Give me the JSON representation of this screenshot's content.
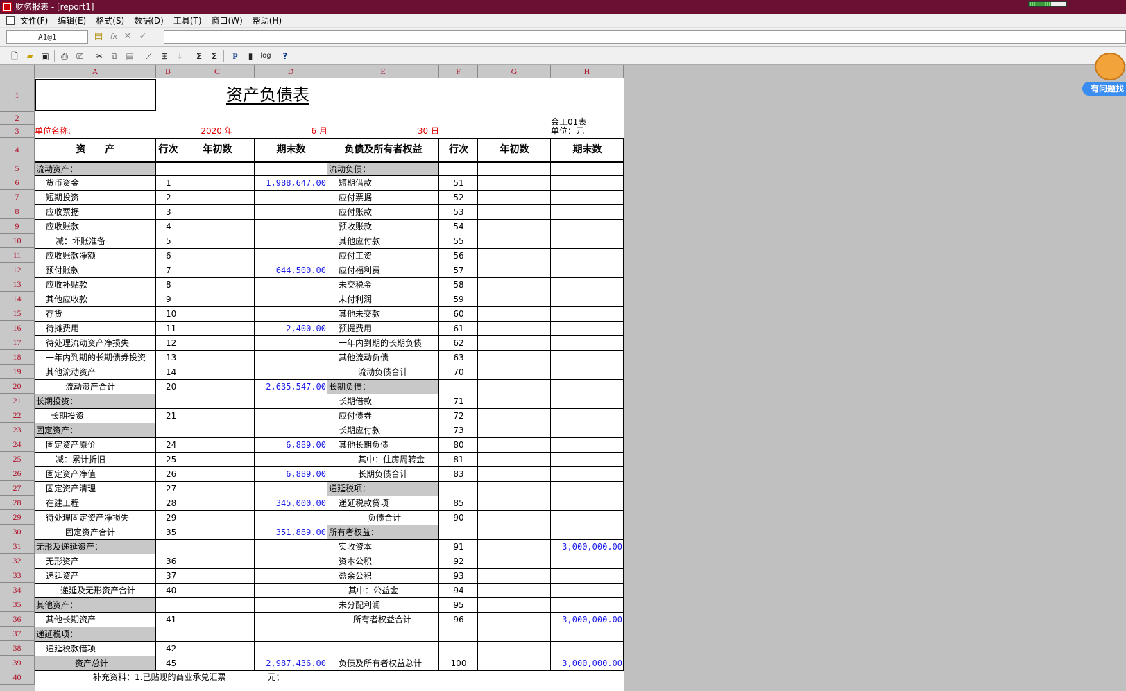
{
  "window": {
    "title": "财务报表 - [report1]",
    "progress_fraction": 0.6
  },
  "menu": [
    "文件(F)",
    "编辑(E)",
    "格式(S)",
    "数据(D)",
    "工具(T)",
    "窗口(W)",
    "帮助(H)"
  ],
  "formula": {
    "cell_ref": "A1@1",
    "fx": "fx",
    "content": ""
  },
  "toolbar": {
    "sum_label": "Σ",
    "sum2_label": "Σ",
    "p_label": "P",
    "log_label": "log",
    "help_label": "?"
  },
  "assistant": {
    "label": "有问题找"
  },
  "columns": [
    "A",
    "B",
    "C",
    "D",
    "E",
    "F",
    "G",
    "H"
  ],
  "rows": [
    "1",
    "2",
    "3",
    "4",
    "5",
    "6",
    "7",
    "8",
    "9",
    "10",
    "11",
    "12",
    "13",
    "14",
    "15",
    "16",
    "17",
    "18",
    "19",
    "20",
    "21",
    "22",
    "23",
    "24",
    "25",
    "26",
    "27",
    "28",
    "29",
    "30",
    "31",
    "32",
    "33",
    "34",
    "35",
    "36",
    "37",
    "38",
    "39",
    "40"
  ],
  "report": {
    "title": "资产负债表",
    "form_no": "会工01表",
    "unit_label": "单位名称:",
    "year": "2020 年",
    "month": "6 月",
    "day": "30 日",
    "currency": "单位：元",
    "headers": {
      "asset": "资　　产",
      "line": "行次",
      "begin": "年初数",
      "end": "期末数",
      "liab": "负债及所有者权益",
      "line2": "行次",
      "begin2": "年初数",
      "end2": "期末数"
    },
    "footer": "补充资料：1.已贴现的商业承兑汇票　　　　　元；",
    "body": [
      {
        "a": "流动资产：",
        "b": "",
        "d": "",
        "e": "流动负债：",
        "f": "",
        "h": "",
        "ash": true,
        "esh": true,
        "ai": 0,
        "ei": 0
      },
      {
        "a": "货币资金",
        "b": "1",
        "d": "1,988,647.00",
        "e": "短期借款",
        "f": "51",
        "h": "",
        "ai": 1,
        "ei": 1
      },
      {
        "a": "短期投资",
        "b": "2",
        "d": "",
        "e": "应付票据",
        "f": "52",
        "h": "",
        "ai": 1,
        "ei": 1
      },
      {
        "a": "应收票据",
        "b": "3",
        "d": "",
        "e": "应付账款",
        "f": "53",
        "h": "",
        "ai": 1,
        "ei": 1
      },
      {
        "a": "应收账款",
        "b": "4",
        "d": "",
        "e": "预收账款",
        "f": "54",
        "h": "",
        "ai": 1,
        "ei": 1
      },
      {
        "a": "减：坏账准备",
        "b": "5",
        "d": "",
        "e": "其他应付款",
        "f": "55",
        "h": "",
        "ai": 2,
        "ei": 1
      },
      {
        "a": "应收账款净额",
        "b": "6",
        "d": "",
        "e": "应付工资",
        "f": "56",
        "h": "",
        "ai": 1,
        "ei": 1
      },
      {
        "a": "预付账款",
        "b": "7",
        "d": "644,500.00",
        "e": "应付福利费",
        "f": "57",
        "h": "",
        "ai": 1,
        "ei": 1
      },
      {
        "a": "应收补贴款",
        "b": "8",
        "d": "",
        "e": "未交税金",
        "f": "58",
        "h": "",
        "ai": 1,
        "ei": 1
      },
      {
        "a": "其他应收款",
        "b": "9",
        "d": "",
        "e": "未付利润",
        "f": "59",
        "h": "",
        "ai": 1,
        "ei": 1
      },
      {
        "a": "存货",
        "b": "10",
        "d": "",
        "e": "其他未交款",
        "f": "60",
        "h": "",
        "ai": 1,
        "ei": 1
      },
      {
        "a": "待摊费用",
        "b": "11",
        "d": "2,400.00",
        "e": "预提费用",
        "f": "61",
        "h": "",
        "ai": 1,
        "ei": 1
      },
      {
        "a": "待处理流动资产净损失",
        "b": "12",
        "d": "",
        "e": "一年内到期的长期负债",
        "f": "62",
        "h": "",
        "ai": 1,
        "ei": 1
      },
      {
        "a": "一年内到期的长期债券投资",
        "b": "13",
        "d": "",
        "e": "其他流动负债",
        "f": "63",
        "h": "",
        "ai": 1,
        "ei": 1
      },
      {
        "a": "其他流动资产",
        "b": "14",
        "d": "",
        "e": "流动负债合计",
        "f": "70",
        "h": "",
        "ai": 1,
        "ei": 3
      },
      {
        "a": "流动资产合计",
        "b": "20",
        "d": "2,635,547.00",
        "e": "长期负债：",
        "f": "",
        "h": "",
        "ai": 3,
        "ei": 0,
        "esh": true
      },
      {
        "a": "长期投资：",
        "b": "",
        "d": "",
        "e": "长期借款",
        "f": "71",
        "h": "",
        "ash": true,
        "ai": 0,
        "ei": 1
      },
      {
        "a": "长期投资",
        "b": "21",
        "d": "",
        "e": "应付债券",
        "f": "72",
        "h": "",
        "ai": 1.5,
        "ei": 1
      },
      {
        "a": "固定资产：",
        "b": "",
        "d": "",
        "e": "长期应付款",
        "f": "73",
        "h": "",
        "ash": true,
        "ai": 0,
        "ei": 1
      },
      {
        "a": "固定资产原价",
        "b": "24",
        "d": "6,889.00",
        "e": "其他长期负债",
        "f": "80",
        "h": "",
        "ai": 1,
        "ei": 1
      },
      {
        "a": "减：累计折旧",
        "b": "25",
        "d": "",
        "e": "其中：住房周转金",
        "f": "81",
        "h": "",
        "ai": 2,
        "ei": 3
      },
      {
        "a": "固定资产净值",
        "b": "26",
        "d": "6,889.00",
        "e": "长期负债合计",
        "f": "83",
        "h": "",
        "ai": 1,
        "ei": 3
      },
      {
        "a": "固定资产清理",
        "b": "27",
        "d": "",
        "e": "递延税项：",
        "f": "",
        "h": "",
        "ai": 1,
        "ei": 0,
        "esh": true
      },
      {
        "a": "在建工程",
        "b": "28",
        "d": "345,000.00",
        "e": "递延税款贷项",
        "f": "85",
        "h": "",
        "ai": 1,
        "ei": 1
      },
      {
        "a": "待处理固定资产净损失",
        "b": "29",
        "d": "",
        "e": "负债合计",
        "f": "90",
        "h": "",
        "ai": 1,
        "ei": 4
      },
      {
        "a": "固定资产合计",
        "b": "35",
        "d": "351,889.00",
        "e": "所有者权益：",
        "f": "",
        "h": "",
        "ai": 3,
        "ei": 0,
        "esh": true
      },
      {
        "a": "无形及递延资产：",
        "b": "",
        "d": "",
        "e": "实收资本",
        "f": "91",
        "h": "3,000,000.00",
        "ash": true,
        "ai": 0,
        "ei": 1
      },
      {
        "a": "无形资产",
        "b": "36",
        "d": "",
        "e": "资本公积",
        "f": "92",
        "h": "",
        "ai": 1,
        "ei": 1
      },
      {
        "a": "递延资产",
        "b": "37",
        "d": "",
        "e": "盈余公积",
        "f": "93",
        "h": "",
        "ai": 1,
        "ei": 1
      },
      {
        "a": "递延及无形资产合计",
        "b": "40",
        "d": "",
        "e": "其中：公益金",
        "f": "94",
        "h": "",
        "ai": 2.5,
        "ei": 2
      },
      {
        "a": "其他资产：",
        "b": "",
        "d": "",
        "e": "未分配利润",
        "f": "95",
        "h": "",
        "ash": true,
        "ai": 0,
        "ei": 1
      },
      {
        "a": "其他长期资产",
        "b": "41",
        "d": "",
        "e": "所有者权益合计",
        "f": "96",
        "h": "3,000,000.00",
        "ai": 1,
        "ei": 2.5
      },
      {
        "a": "递延税项：",
        "b": "",
        "d": "",
        "e": "",
        "f": "",
        "h": "",
        "ash": true,
        "ai": 0,
        "ei": 0
      },
      {
        "a": "递延税款借项",
        "b": "42",
        "d": "",
        "e": "",
        "f": "",
        "h": "",
        "ai": 1,
        "ei": 0
      },
      {
        "a": "资产总计",
        "b": "45",
        "d": "2,987,436.00",
        "e": "负债及所有者权益总计",
        "f": "100",
        "h": "3,000,000.00",
        "ash": true,
        "ai": 4,
        "ei": 1
      }
    ]
  }
}
